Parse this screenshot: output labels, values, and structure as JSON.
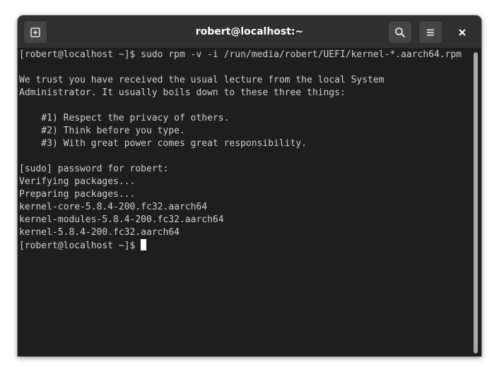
{
  "window": {
    "title": "robert@localhost:~"
  },
  "header": {
    "new_tab_icon": "new-tab-icon",
    "search_icon": "search-icon",
    "menu_icon": "hamburger-menu-icon",
    "close_icon": "close-icon"
  },
  "terminal": {
    "lines": [
      "[robert@localhost ~]$ sudo rpm -v -i /run/media/robert/UEFI/kernel-*.aarch64.rpm",
      "",
      "We trust you have received the usual lecture from the local System",
      "Administrator. It usually boils down to these three things:",
      "",
      "    #1) Respect the privacy of others.",
      "    #2) Think before you type.",
      "    #3) With great power comes great responsibility.",
      "",
      "[sudo] password for robert:",
      "Verifying packages...",
      "Preparing packages...",
      "kernel-core-5.8.4-200.fc32.aarch64",
      "kernel-modules-5.8.4-200.fc32.aarch64",
      "kernel-5.8.4-200.fc32.aarch64"
    ],
    "prompt": "[robert@localhost ~]$"
  },
  "colors": {
    "titlebar_bg": "#303030",
    "terminal_bg": "#1e1e1e",
    "terminal_fg": "#d0d0d0",
    "cursor": "#ffffff"
  }
}
